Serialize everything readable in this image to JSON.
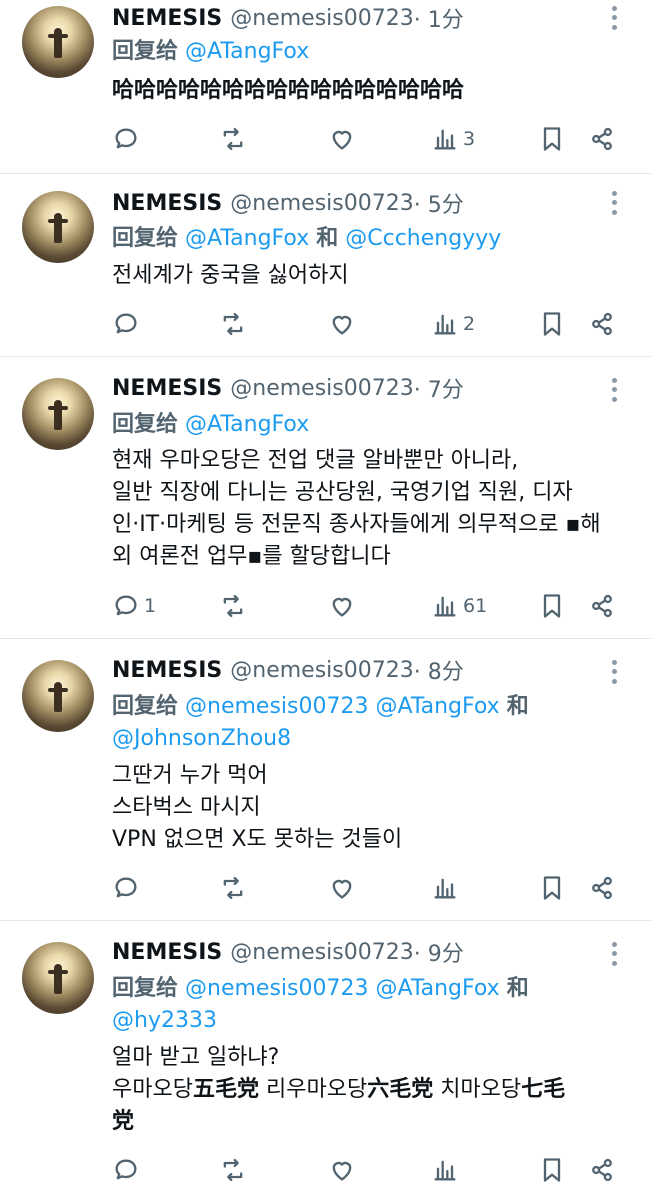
{
  "tweets": [
    {
      "name": "NEMESIS",
      "handle": "@nemesis00723",
      "time": " · 1分",
      "reply_label": "回复给",
      "reply_to_line1": "@ATangFox",
      "lines": [
        "哈哈哈哈哈哈哈哈哈哈哈哈哈哈哈哈"
      ],
      "replies": "",
      "views": "3"
    },
    {
      "name": "NEMESIS",
      "handle": "@nemesis00723",
      "time": " · 5分",
      "reply_label": "回复给",
      "reply_to_line1": "@ATangFox",
      "reply_conj": "和",
      "reply_to_line1b": "@Ccchengyyy",
      "lines": [
        "전세계가 중국을 싫어하지"
      ],
      "replies": "",
      "views": "2"
    },
    {
      "name": "NEMESIS",
      "handle": "@nemesis00723",
      "time": " · 7分",
      "reply_label": "回复给",
      "reply_to_line1": "@ATangFox",
      "lines": [
        "현재 우마오당은 전업 댓글 알바뿐만 아니라,",
        "일반 직장에 다니는 공산당원, 국영기업 직원, 디자",
        "인·IT·마케팅 등 전문직 종사자들에게 의무적으로 ▪해",
        "외 여론전  업무▪를 할당합니다"
      ],
      "replies": "1",
      "views": "61"
    },
    {
      "name": "NEMESIS",
      "handle": "@nemesis00723",
      "time": " · 8分",
      "reply_label": "回复给",
      "reply_to_line1": "@nemesis00723 @ATangFox",
      "reply_conj": "和",
      "reply_to_line2": "@JohnsonZhou8",
      "lines": [
        "그딴거 누가 먹어",
        "스타벅스 마시지",
        "VPN 없으면 X도 못하는 것들이"
      ],
      "replies": "",
      "views": ""
    },
    {
      "name": "NEMESIS",
      "handle": "@nemesis00723",
      "time": " · 9分",
      "reply_label": "回复给",
      "reply_to_line1": "@nemesis00723 @ATangFox",
      "reply_conj": "和",
      "reply_to_line2": "@hy2333",
      "line1": "얼마 받고 일하냐?",
      "line2_a": "우마오당",
      "line2_b": "五毛党",
      "line2_c": " 리우마오당",
      "line2_d": "六毛党",
      "line2_e": " 치마오당",
      "line2_f": "七毛",
      "line3": "党",
      "replies": "",
      "views": ""
    }
  ],
  "icons": {
    "reply": "speech-bubble-icon",
    "retweet": "retweet-icon",
    "like": "heart-icon",
    "views": "bar-chart-icon",
    "bookmark": "bookmark-icon",
    "share": "share-icon",
    "more": "three-dots-vertical-icon"
  },
  "colors": {
    "link": "#1d9bf0",
    "muted": "#536471",
    "text": "#0f1419"
  }
}
